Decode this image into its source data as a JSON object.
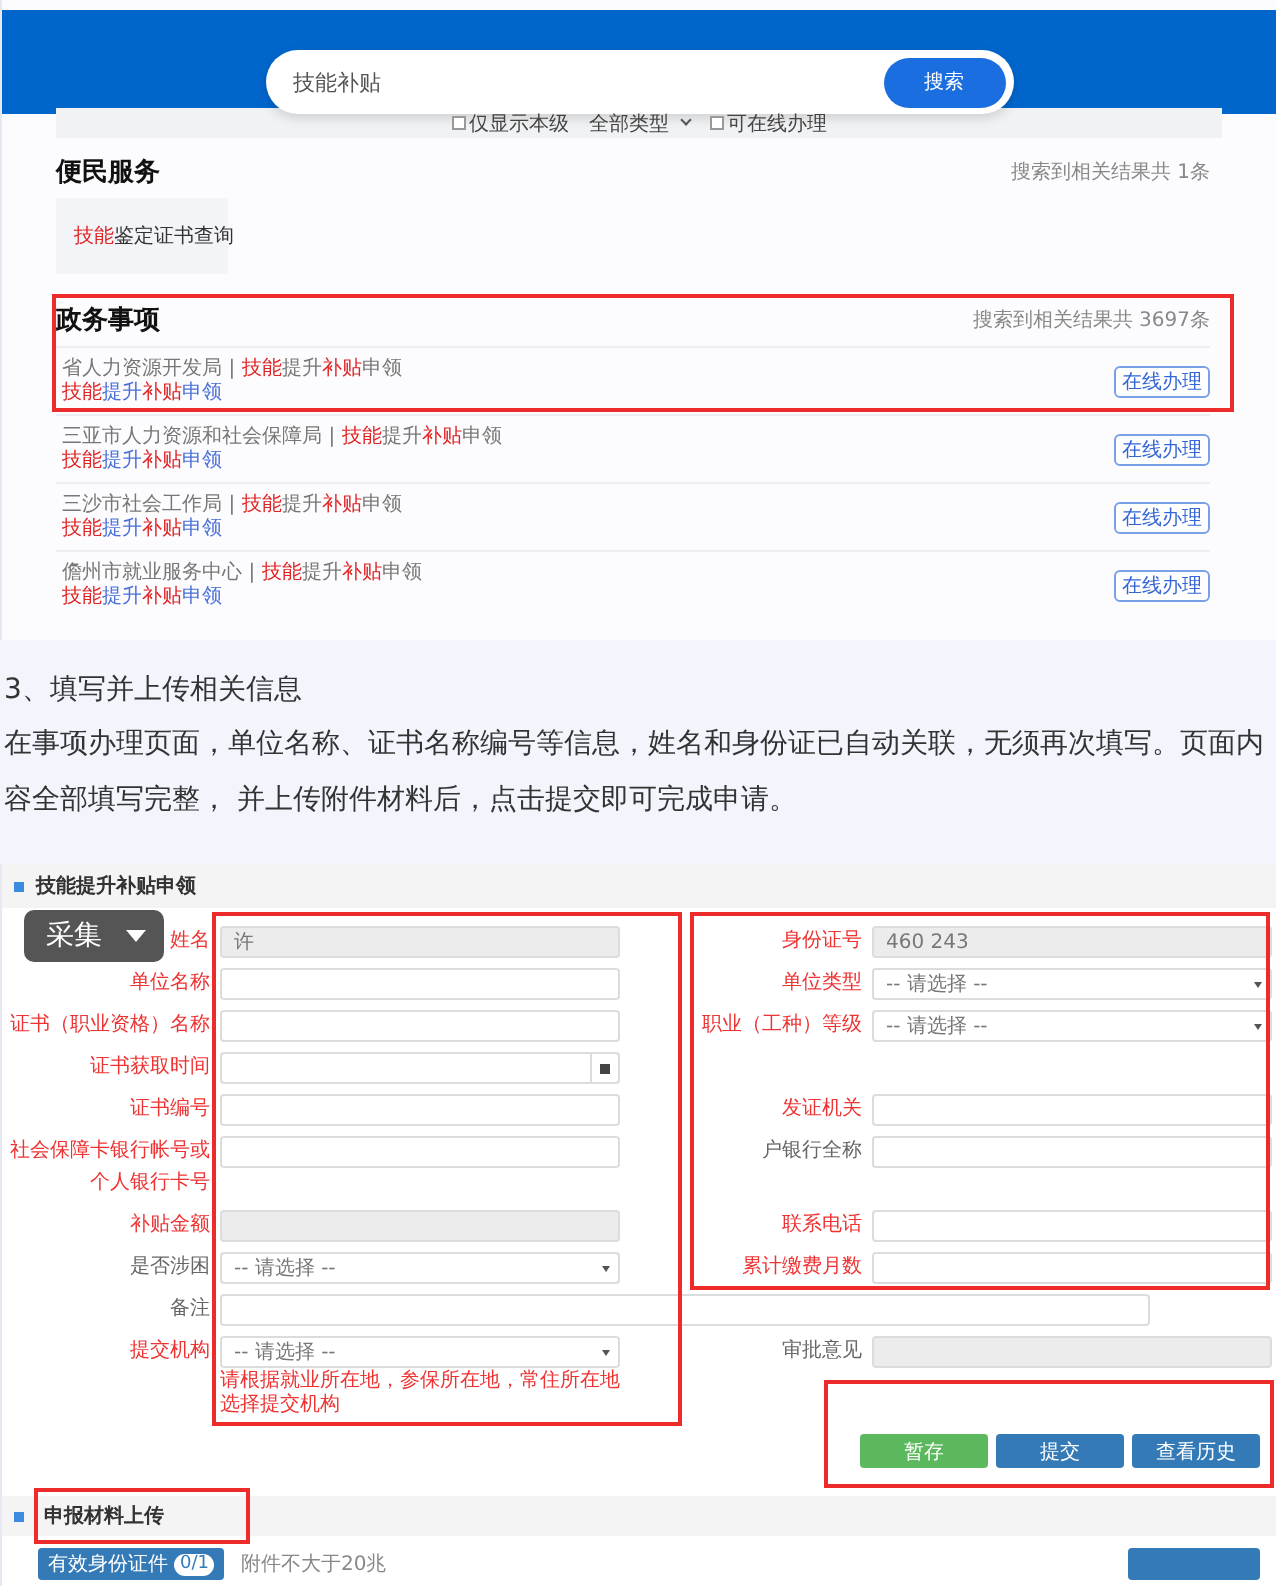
{
  "search": {
    "value": "技能补贴",
    "button": "搜索"
  },
  "filters": [
    {
      "kind": "checkbox",
      "label": "仅显示本级",
      "checked": false
    },
    {
      "kind": "dropdown",
      "label": "全部类型"
    },
    {
      "kind": "checkbox",
      "label": "可在线办理",
      "checked": false
    }
  ],
  "services": {
    "title": "便民服务",
    "count": "搜索到相关结果共 1条",
    "items": [
      "**技能**鉴定证书查询"
    ]
  },
  "affairs": {
    "title": "政务事项",
    "count": "搜索到相关结果共 3697条",
    "items": [
      {
        "org": "省人力资源开发局",
        "separator": "|",
        "name": "**技能**提升**补贴**申领",
        "subtitle": "**技能**提升**补贴**申领",
        "button": "在线办理"
      },
      {
        "org": "三亚市人力资源和社会保障局",
        "separator": "|",
        "name": "**技能**提升**补贴**申领",
        "subtitle": "**技能**提升**补贴**申领",
        "button": "在线办理"
      },
      {
        "org": "三沙市社会工作局",
        "separator": "|",
        "name": "**技能**提升**补贴**申领",
        "subtitle": "**技能**提升**补贴**申领",
        "button": "在线办理"
      },
      {
        "org": "儋州市就业服务中心",
        "separator": "|",
        "name": "**技能**提升**补贴**申领",
        "subtitle": "**技能**提升**补贴**申领",
        "button": "在线办理"
      }
    ]
  },
  "step": {
    "heading": "3、填写并上传相关信息",
    "body": "在事项办理页面，单位名称、证书名称编号等信息，姓名和身份证已自动关联，无须再次填写。页面内容全部填写完整， 并上传附件材料后，点击提交即可完成申请。"
  },
  "overlay": {
    "label": "采集"
  },
  "form": {
    "title": "技能提升补贴申领",
    "rows": [
      {
        "left": {
          "label": "姓名",
          "required": true,
          "kind": "readonly",
          "value": "许"
        },
        "right": {
          "label": "身份证号",
          "required": true,
          "kind": "readonly",
          "value": "460 243"
        }
      },
      {
        "left": {
          "label": "单位名称",
          "required": true,
          "kind": "text"
        },
        "right": {
          "label": "单位类型",
          "required": true,
          "kind": "select",
          "placeholder": "-- 请选择 --"
        }
      },
      {
        "left": {
          "label": "证书（职业资格）名称",
          "required": true,
          "kind": "text"
        },
        "right": {
          "label": "职业（工种）等级",
          "required": true,
          "kind": "select",
          "placeholder": "-- 请选择 --"
        }
      },
      {
        "left": {
          "label": "证书获取时间",
          "required": true,
          "kind": "date"
        }
      },
      {
        "left": {
          "label": "证书编号",
          "required": true,
          "kind": "text"
        },
        "right": {
          "label": "发证机关",
          "required": true,
          "kind": "text"
        }
      },
      {
        "left": {
          "label": "社会保障卡银行帐号或个人银行卡号",
          "required": true,
          "kind": "text"
        },
        "right": {
          "label": "户银行全称",
          "required": false,
          "kind": "text"
        }
      },
      {
        "left": {
          "label": "补贴金额",
          "required": true,
          "kind": "readonly"
        },
        "right": {
          "label": "联系电话",
          "required": true,
          "kind": "text"
        }
      },
      {
        "left": {
          "label": "是否涉困",
          "required": false,
          "kind": "select",
          "placeholder": "-- 请选择 --"
        },
        "right": {
          "label": "累计缴费月数",
          "required": true,
          "kind": "text"
        }
      },
      {
        "left": {
          "label": "备注",
          "required": false,
          "kind": "wide"
        }
      },
      {
        "left": {
          "label": "提交机构",
          "required": true,
          "kind": "select",
          "placeholder": "-- 请选择 --",
          "hint": "请根据就业所在地，参保所在地，常住所在地选择提交机构"
        },
        "right": {
          "label": "审批意见",
          "required": false,
          "kind": "readonly"
        }
      }
    ],
    "buttons": [
      {
        "label": "暂存",
        "kind": "save"
      },
      {
        "label": "提交",
        "kind": "primary"
      },
      {
        "label": "查看历史",
        "kind": "primary"
      }
    ]
  },
  "upload": {
    "title": "申报材料上传",
    "file_button": "有效身份证件",
    "file_count": "0/1",
    "note": "附件不大于20兆"
  }
}
